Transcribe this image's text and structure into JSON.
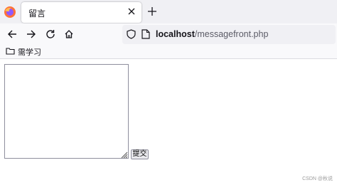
{
  "browser": {
    "tab": {
      "title": "留言"
    },
    "url": {
      "host": "localhost",
      "path": "/messagefront.php"
    },
    "bookmarks": [
      {
        "label": "需学习"
      }
    ]
  },
  "page": {
    "textarea_value": "",
    "submit_label": "提交"
  },
  "watermark": "CSDN @秋说",
  "colors": {
    "chrome": "#f0f0f4",
    "toolbar": "#f9f9fb",
    "text": "#15141a",
    "path": "#5b5b66"
  }
}
